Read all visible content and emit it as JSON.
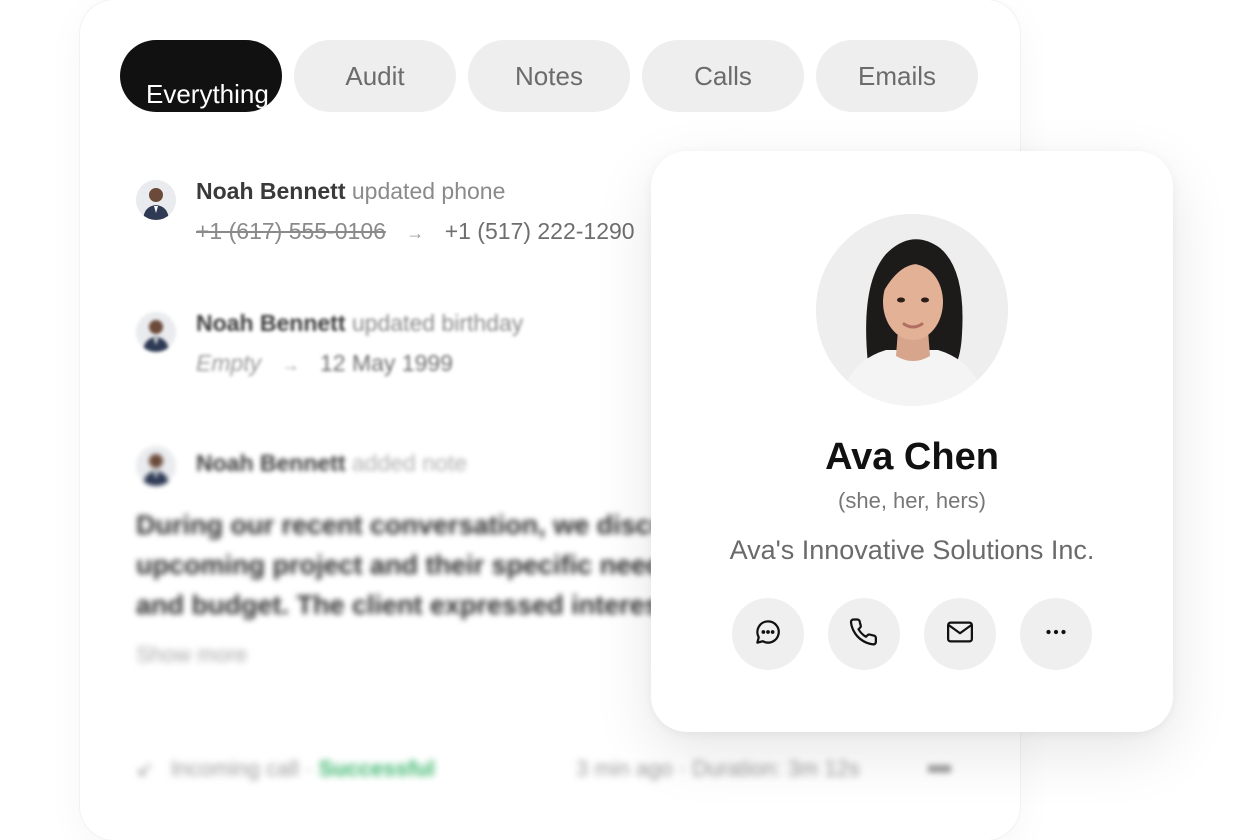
{
  "tabs": [
    {
      "label": "Everything",
      "active": true
    },
    {
      "label": "Audit",
      "active": false
    },
    {
      "label": "Notes",
      "active": false
    },
    {
      "label": "Calls",
      "active": false
    },
    {
      "label": "Emails",
      "active": false
    }
  ],
  "activity": [
    {
      "user": "Noah Bennett",
      "action": "updated phone",
      "old_value": "+1 (617) 555-0106",
      "new_value": "+1 (517) 222-1290"
    },
    {
      "user": "Noah Bennett",
      "action": "updated birthday",
      "old_value": "Empty",
      "new_value": "12 May 1999"
    },
    {
      "user": "Noah Bennett",
      "action": "added note"
    }
  ],
  "note": {
    "lines": [
      "During our recent conversation, we discussed the",
      "upcoming project and their specific needs",
      "and budget. The client expressed interest"
    ],
    "show_more": "Show more"
  },
  "call": {
    "type": "Incoming call",
    "separator": "·",
    "status": "Successful",
    "time": "3 min ago",
    "duration": "Duration: 3m 12s"
  },
  "contact": {
    "name": "Ava Chen",
    "pronouns": "(she, her, hers)",
    "company": "Ava's Innovative Solutions Inc."
  },
  "icons": {
    "message": "chat-bubble-icon",
    "call": "phone-icon",
    "email": "mail-icon",
    "more": "more-horizontal-icon"
  },
  "colors": {
    "active_tab": "#111111",
    "tab_bg": "#eeeeee",
    "success": "#39b56a"
  }
}
